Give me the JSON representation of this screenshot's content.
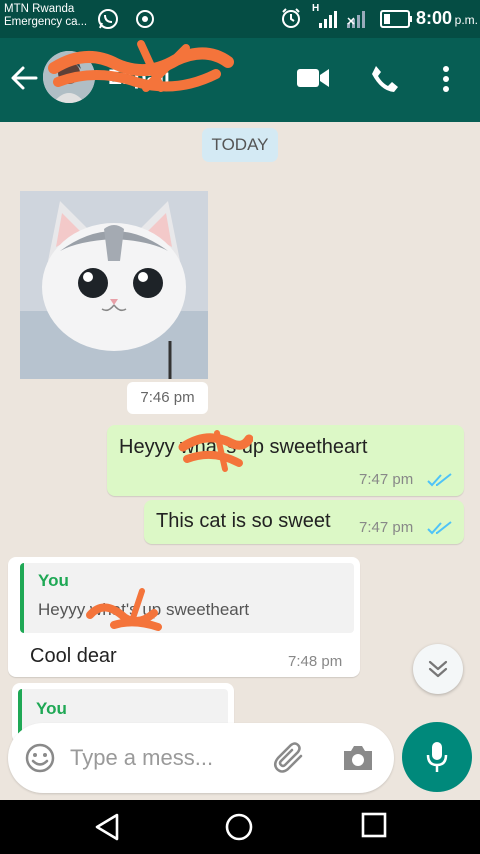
{
  "status_bar": {
    "carrier_line1": "MTN Rwanda",
    "carrier_line2": "Emergency ca...",
    "time": "8:00",
    "ampm": "p.m.",
    "network": "H"
  },
  "header": {
    "contact_name": "Ekpali"
  },
  "chat": {
    "date_label": "TODAY",
    "image_time": "7:46 pm",
    "messages": [
      {
        "text": "Heyyy       what's up sweetheart",
        "time": "7:47 pm"
      },
      {
        "text": "This cat is so sweet",
        "time": "7:47 pm"
      },
      {
        "quote_author": "You",
        "quote_text": "Heyyy            what's up sweetheart",
        "text": "Cool dear",
        "time": "7:48 pm"
      },
      {
        "quote_author": "You"
      }
    ]
  },
  "composer": {
    "placeholder": "Type a mess..."
  },
  "colors": {
    "header": "#075e54",
    "status_bar": "#054d44",
    "outgoing_bubble": "#dcf8c6",
    "accent": "#00897b",
    "read_ticks": "#4fc3f7",
    "scribble": "#f4743b"
  }
}
